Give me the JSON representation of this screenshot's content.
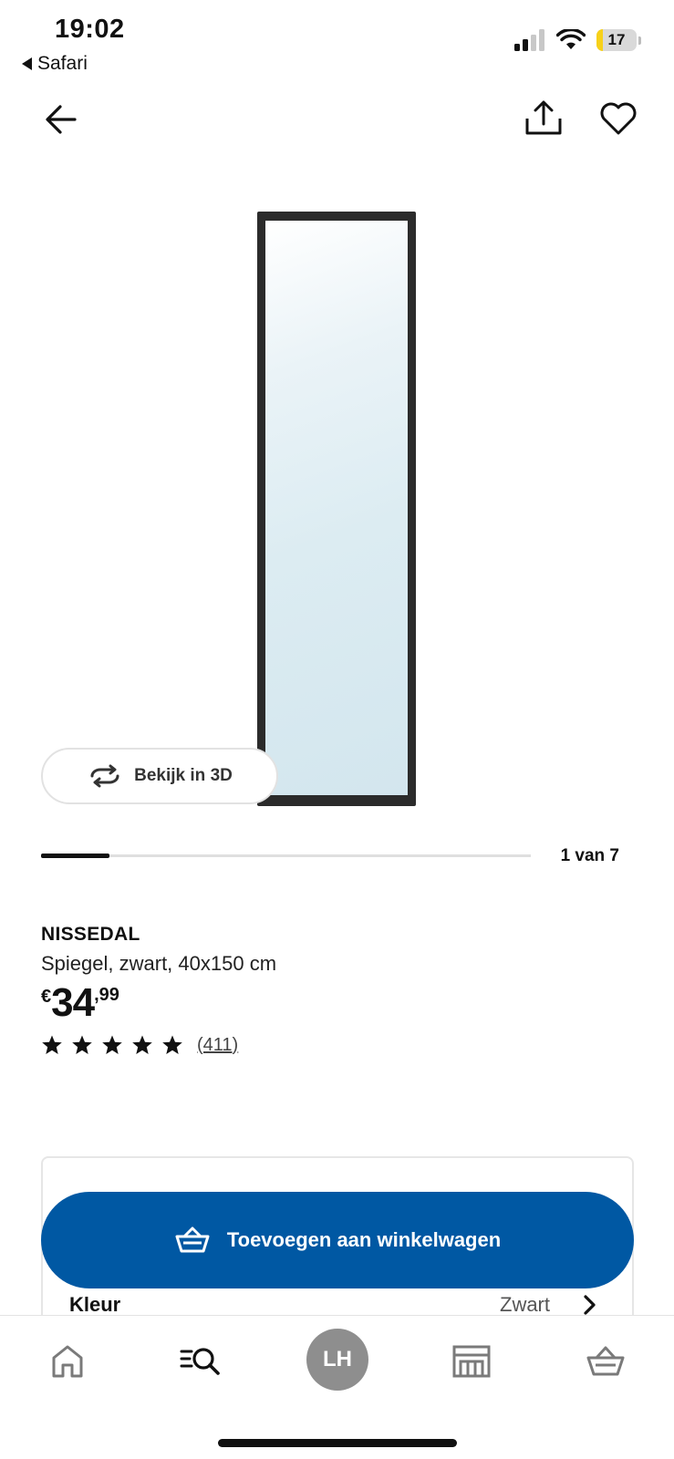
{
  "status_bar": {
    "time": "19:02",
    "back_app": "Safari",
    "battery": "17",
    "battery_level": 0.17,
    "icons": [
      "signal-icon",
      "wifi-icon",
      "battery-icon"
    ]
  },
  "nav": {
    "icons": [
      "arrow-left-icon",
      "share-icon",
      "heart-icon"
    ]
  },
  "media": {
    "view_3d_label": "Bekijk in 3D",
    "pager_label": "1 van 7",
    "pager_progress": 0.14
  },
  "product": {
    "name": "NISSEDAL",
    "description": "Spiegel, zwart, 40x150 cm",
    "price_currency": "€",
    "price_int": "34",
    "price_dec": ",99",
    "rating": 5,
    "review_count": "(411)"
  },
  "cart": {
    "add_label": "Toevoegen aan winkelwagen",
    "accent_color": "#0058a3"
  },
  "options": {
    "color_label": "Kleur",
    "color_value": "Zwart"
  },
  "tabbar": {
    "avatar_initials": "LH",
    "icons": [
      "home-icon",
      "search-icon",
      "profile-avatar",
      "store-icon",
      "basket-icon"
    ]
  }
}
